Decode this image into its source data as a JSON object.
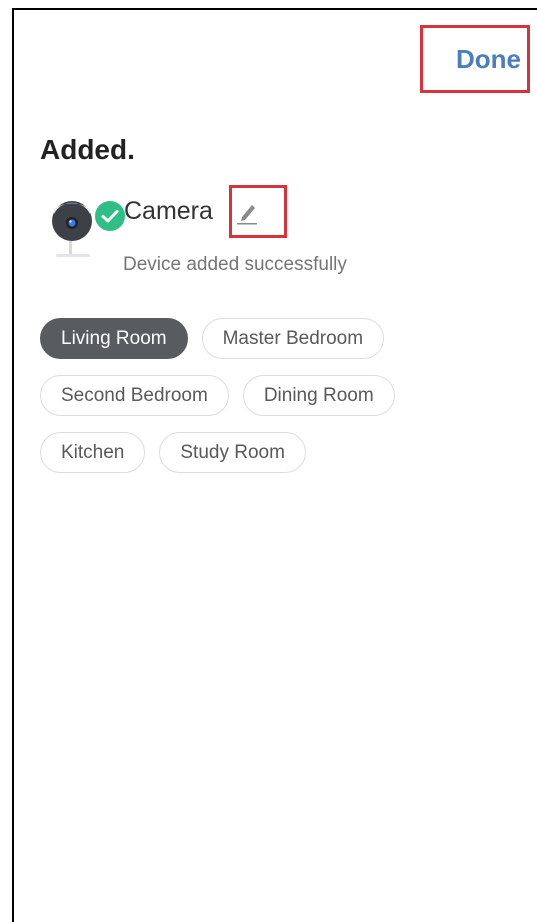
{
  "header": {
    "done_label": "Done"
  },
  "page": {
    "title": "Added."
  },
  "device": {
    "name": "Camera",
    "status": "Device added successfully",
    "icon": "camera-icon",
    "badge_icon": "check-circle-icon",
    "edit_icon": "pencil-icon"
  },
  "rooms": {
    "selected": "Living Room",
    "items": [
      {
        "label": "Living Room"
      },
      {
        "label": "Master Bedroom"
      },
      {
        "label": "Second Bedroom"
      },
      {
        "label": "Dining Room"
      },
      {
        "label": "Kitchen"
      },
      {
        "label": "Study Room"
      }
    ]
  },
  "colors": {
    "accent": "#4a7ec0",
    "success": "#2fbf86",
    "selected_chip": "#585c61",
    "highlight": "#d8323c"
  }
}
